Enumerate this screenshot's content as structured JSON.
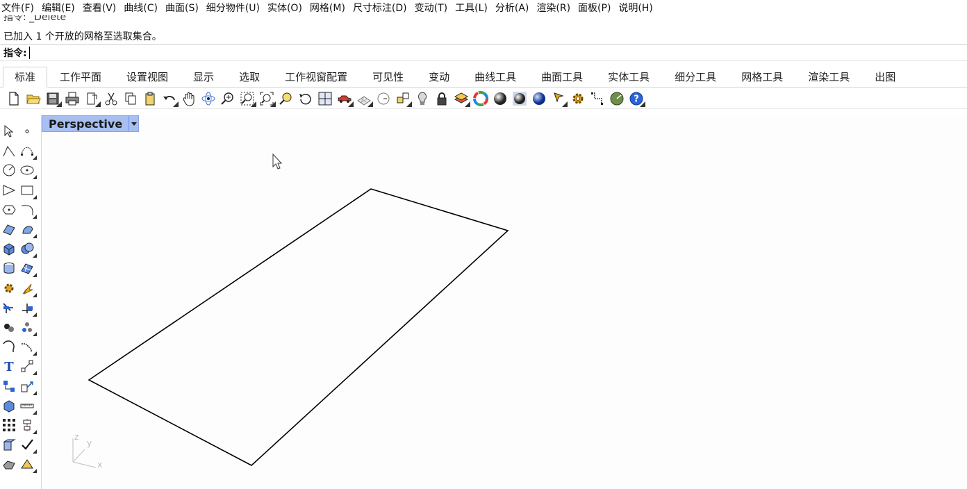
{
  "menu": [
    "文件(F)",
    "编辑(E)",
    "查看(V)",
    "曲线(C)",
    "曲面(S)",
    "细分物件(U)",
    "实体(O)",
    "网格(M)",
    "尺寸标注(D)",
    "变动(T)",
    "工具(L)",
    "分析(A)",
    "渲染(R)",
    "面板(P)",
    "说明(H)"
  ],
  "command": {
    "history_partial": "指令: _Delete",
    "history_line": "已加入 1 个开放的网格至选取集合。",
    "prompt_label": "指令:",
    "input_value": ""
  },
  "tabs": [
    "标准",
    "工作平面",
    "设置视图",
    "显示",
    "选取",
    "工作视窗配置",
    "可见性",
    "变动",
    "曲线工具",
    "曲面工具",
    "实体工具",
    "细分工具",
    "网格工具",
    "渲染工具",
    "出图"
  ],
  "active_tab": "标准",
  "toolbar_icons": [
    "new-icon",
    "open-icon",
    "save-icon",
    "print-icon",
    "import-icon",
    "cut-icon",
    "copy-icon",
    "paste-icon",
    "undo-icon",
    "pan-icon",
    "rotate-view-icon",
    "zoom-icon",
    "zoom-window-icon",
    "zoom-extents-icon",
    "zoom-selected-icon",
    "undo-view-icon",
    "viewport-layout-icon",
    "car-icon",
    "grid-plane-icon",
    "circle-icon",
    "properties-icon",
    "light-icon",
    "lock-icon",
    "layer-icon",
    "color-wheel-icon",
    "sphere-shaded-icon",
    "sphere-render-icon",
    "sphere-blue-icon",
    "cursor-icon",
    "gear-icon",
    "dim-icon",
    "globe-icon",
    "help-icon"
  ],
  "left_tools": [
    "select-icon",
    "point-icon",
    "polyline-icon",
    "curve-icon",
    "circle-icon",
    "ellipse-icon",
    "polygon-icon",
    "rectangle-icon",
    "hexagon-icon",
    "arc-fillet-icon",
    "surface-icon",
    "revolve-icon",
    "box-icon",
    "boolean-icon",
    "cylinder-icon",
    "mesh-icon",
    "gear-tool-icon",
    "flash-icon",
    "trim-icon",
    "split-icon",
    "join-icon",
    "explode-icon",
    "fillet-icon",
    "chamfer-icon",
    "text-icon",
    "scale-icon",
    "array-icon",
    "move-icon",
    "block-icon",
    "ruler-icon",
    "grid-icon",
    "align-icon",
    "extrude-icon",
    "check-icon",
    "solid-icon",
    "render-icon"
  ],
  "viewport": {
    "title": "Perspective",
    "axis_labels": {
      "z": "z",
      "y": "y",
      "x": "x"
    }
  },
  "colors": {
    "viewport_tab": "#a8bff2",
    "background": "#fdfdfd"
  }
}
